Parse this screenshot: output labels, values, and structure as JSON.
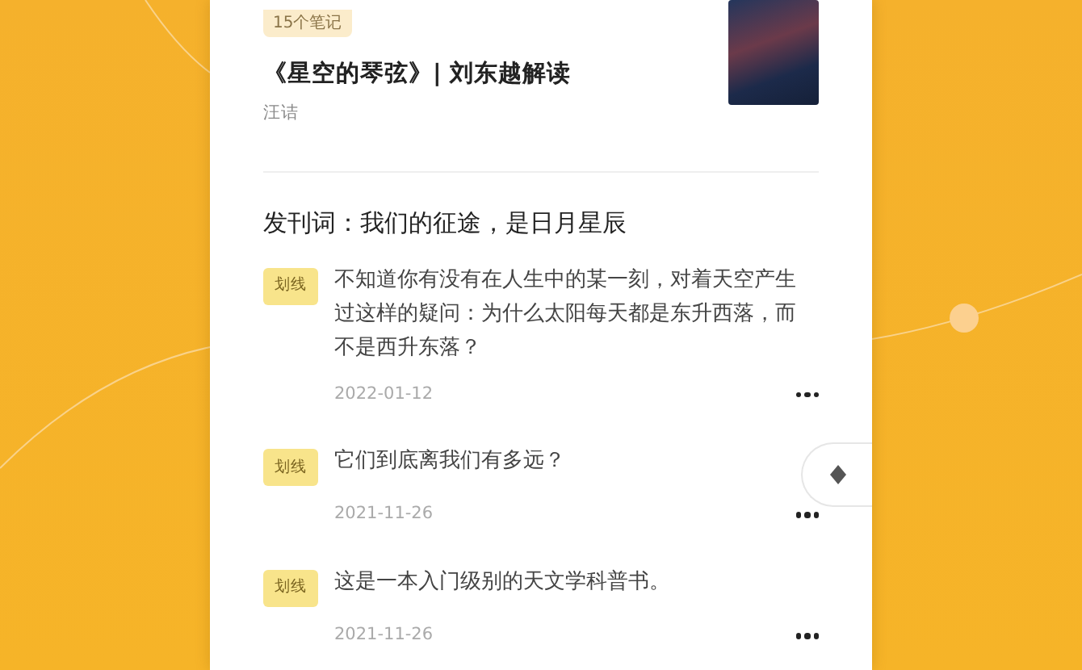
{
  "book": {
    "note_count": "15个笔记",
    "title": "《星空的琴弦》| 刘东越解读",
    "author": "汪诘"
  },
  "chapter": {
    "title": "发刊词：我们的征途，是日月星辰"
  },
  "notes": [
    {
      "tag": "划线",
      "text": "不知道你有没有在人生中的某一刻，对着天空产生过这样的疑问：为什么太阳每天都是东升西落，而不是西升东落？",
      "date": "2022-01-12"
    },
    {
      "tag": "划线",
      "text": "它们到底离我们有多远？",
      "date": "2021-11-26"
    },
    {
      "tag": "划线",
      "text": "这是一本入门级别的天文学科普书。",
      "date": "2021-11-26"
    }
  ]
}
